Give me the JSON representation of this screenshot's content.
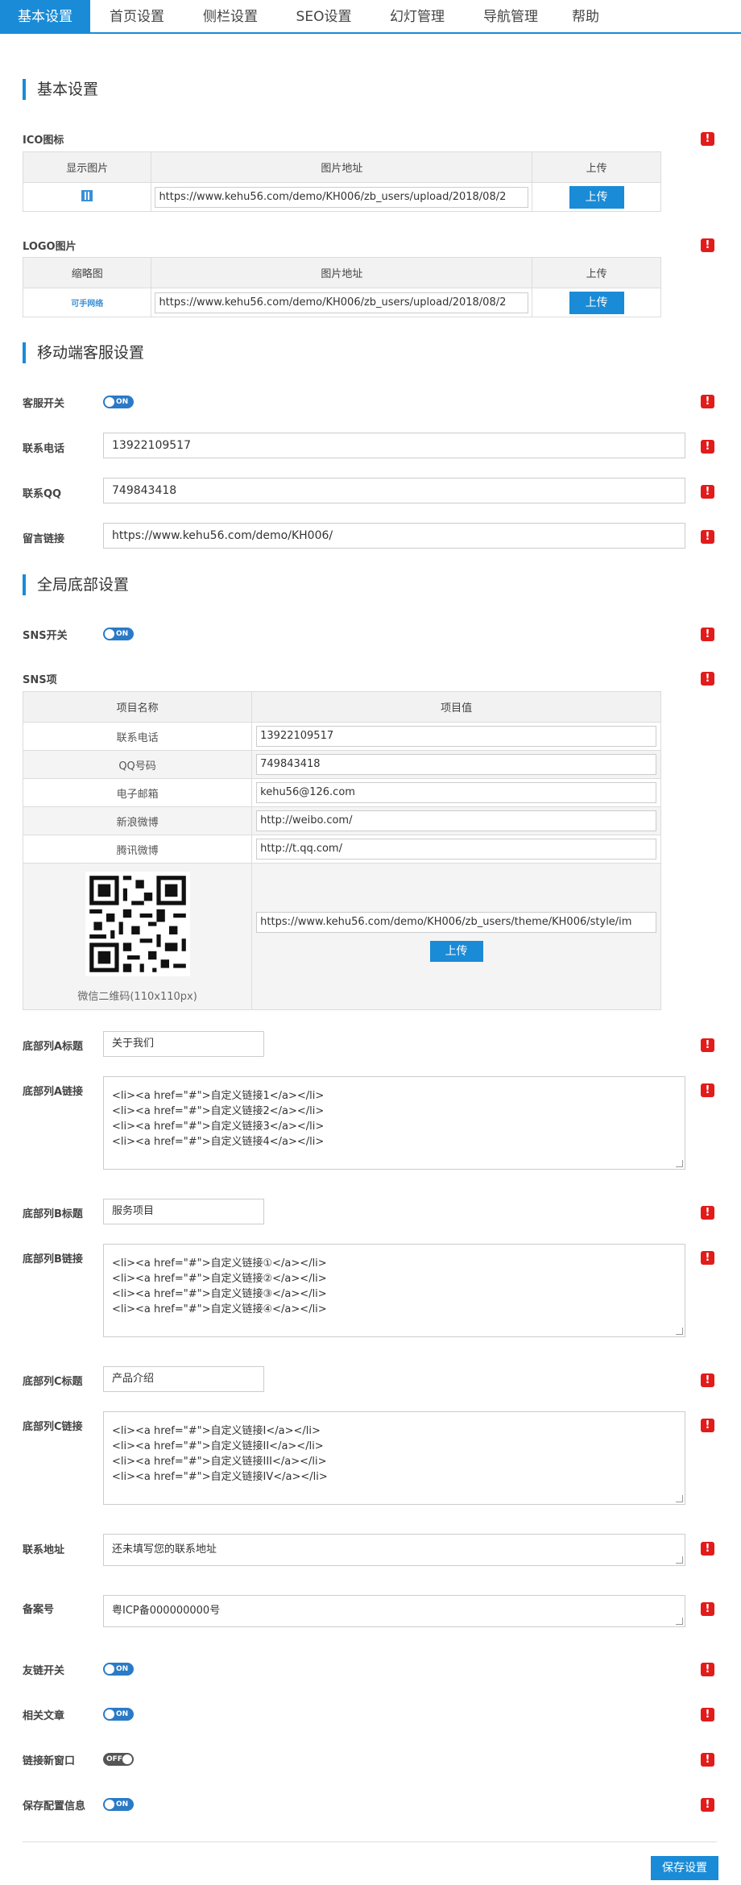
{
  "tabs": [
    "基本设置",
    "首页设置",
    "侧栏设置",
    "SEO设置",
    "幻灯管理",
    "导航管理",
    "帮助"
  ],
  "warn_glyph": "!",
  "basic": {
    "section_title": "基本设置",
    "ico": {
      "label": "ICO图标",
      "headers": [
        "显示图片",
        "图片地址",
        "上传"
      ],
      "url": "https://www.kehu56.com/demo/KH006/zb_users/upload/2018/08/2",
      "button": "上传",
      "preview_icon": "qr-favicon"
    },
    "logo": {
      "label": "LOGO图片",
      "headers": [
        "缩略图",
        "图片地址",
        "上传"
      ],
      "url": "https://www.kehu56.com/demo/KH006/zb_users/upload/2018/08/2",
      "button": "上传",
      "logo_text": "可手网络"
    }
  },
  "mobile": {
    "section_title": "移动端客服设置",
    "kefu_label": "客服开关",
    "kefu_toggle": "ON",
    "phone_label": "联系电话",
    "phone_value": "13922109517",
    "qq_label": "联系QQ",
    "qq_value": "749843418",
    "msg_label": "留言链接",
    "msg_value": "https://www.kehu56.com/demo/KH006/"
  },
  "footer": {
    "section_title": "全局底部设置",
    "sns_label": "SNS开关",
    "sns_toggle": "ON",
    "sns_items_label": "SNS项",
    "sns_headers": [
      "项目名称",
      "项目值"
    ],
    "sns_rows": [
      {
        "name": "联系电话",
        "value": "13922109517"
      },
      {
        "name": "QQ号码",
        "value": "749843418"
      },
      {
        "name": "电子邮箱",
        "value": "kehu56@126.com"
      },
      {
        "name": "新浪微博",
        "value": "http://weibo.com/"
      },
      {
        "name": "腾讯微博",
        "value": "http://t.qq.com/"
      }
    ],
    "qr_caption": "微信二维码(110x110px)",
    "qr_url": "https://www.kehu56.com/demo/KH006/zb_users/theme/KH006/style/im",
    "qr_button": "上传",
    "colA_title_label": "底部列A标题",
    "colA_title": "关于我们",
    "colA_links_label": "底部列A链接",
    "colA_links": "<li><a href=\"#\">自定义链接1</a></li>\n<li><a href=\"#\">自定义链接2</a></li>\n<li><a href=\"#\">自定义链接3</a></li>\n<li><a href=\"#\">自定义链接4</a></li>",
    "colB_title_label": "底部列B标题",
    "colB_title": "服务项目",
    "colB_links_label": "底部列B链接",
    "colB_links": "<li><a href=\"#\">自定义链接①</a></li>\n<li><a href=\"#\">自定义链接②</a></li>\n<li><a href=\"#\">自定义链接③</a></li>\n<li><a href=\"#\">自定义链接④</a></li>",
    "colC_title_label": "底部列C标题",
    "colC_title": "产品介绍",
    "colC_links_label": "底部列C链接",
    "colC_links": "<li><a href=\"#\">自定义链接I</a></li>\n<li><a href=\"#\">自定义链接II</a></li>\n<li><a href=\"#\">自定义链接III</a></li>\n<li><a href=\"#\">自定义链接IV</a></li>",
    "address_label": "联系地址",
    "address_value": "还未填写您的联系地址",
    "icp_label": "备案号",
    "icp_value": "粤ICP备000000000号",
    "friendlink_label": "友链开关",
    "friendlink_toggle": "ON",
    "related_label": "相关文章",
    "related_toggle": "ON",
    "newwin_label": "链接新窗口",
    "newwin_toggle": "OFF",
    "saveinfo_label": "保存配置信息",
    "saveinfo_toggle": "ON"
  },
  "save_button": "保存设置",
  "colors": {
    "accent": "#1a8bd6",
    "warn": "#e21b1b"
  }
}
